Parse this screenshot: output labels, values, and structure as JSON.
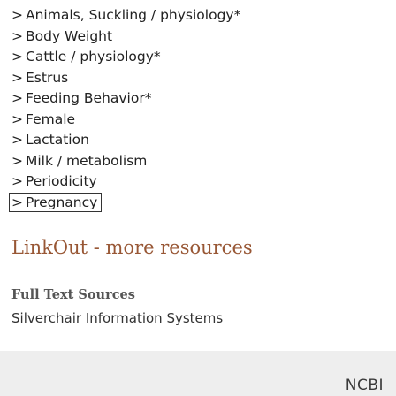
{
  "mesh_terms": {
    "chevron": ">",
    "items": [
      {
        "label": "Animals, Suckling / physiology*"
      },
      {
        "label": "Body Weight"
      },
      {
        "label": "Cattle / physiology*"
      },
      {
        "label": "Estrus"
      },
      {
        "label": "Feeding Behavior*"
      },
      {
        "label": "Female"
      },
      {
        "label": "Lactation"
      },
      {
        "label": "Milk / metabolism"
      },
      {
        "label": "Periodicity"
      },
      {
        "label": "Pregnancy"
      }
    ],
    "selected_index": 9
  },
  "linkout": {
    "heading": "LinkOut - more resources",
    "section_title": "Full Text Sources",
    "source_link": "Silverchair Information Systems"
  },
  "footer": {
    "logo_text": "NCBI",
    "background_color": "#eeeeee"
  },
  "colors": {
    "heading": "#985735",
    "text": "#222222"
  }
}
